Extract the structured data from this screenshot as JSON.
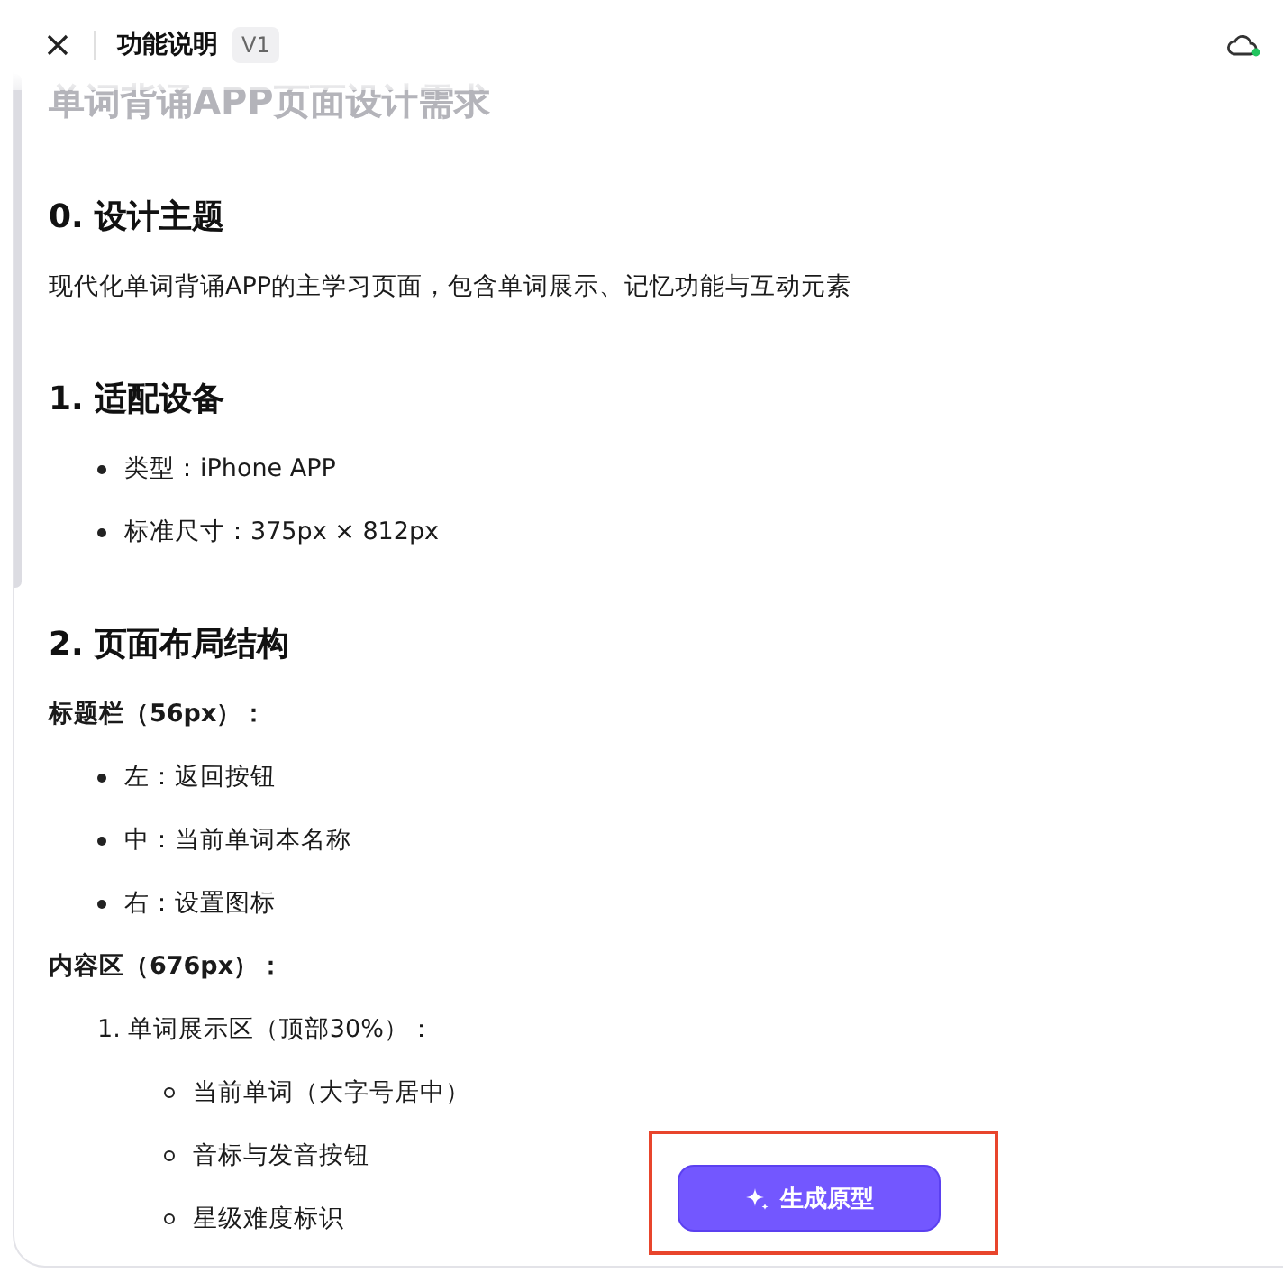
{
  "header": {
    "title": "功能说明",
    "version": "V1",
    "synced": true
  },
  "document": {
    "title": "单词背诵APP页面设计需求",
    "sections": [
      {
        "heading": "0. 设计主题",
        "blocks": [
          {
            "kind": "paragraph",
            "text": "现代化单词背诵APP的主学习页面，包含单词展示、记忆功能与互动元素"
          }
        ]
      },
      {
        "heading": "1. 适配设备",
        "blocks": [
          {
            "kind": "bullets",
            "items": [
              "类型：iPhone APP",
              "标准尺寸：375px × 812px"
            ]
          }
        ]
      },
      {
        "heading": "2. 页面布局结构",
        "blocks": [
          {
            "kind": "label",
            "text": "标题栏（56px）："
          },
          {
            "kind": "bullets",
            "items": [
              "左：返回按钮",
              "中：当前单词本名称",
              "右：设置图标"
            ]
          },
          {
            "kind": "label",
            "text": "内容区（676px）："
          },
          {
            "kind": "numbered",
            "items": [
              {
                "number": "1.",
                "text": "单词展示区（顶部30%）：",
                "children": [
                  "当前单词（大字号居中）",
                  "音标与发音按钮",
                  "星级难度标识"
                ]
              }
            ]
          }
        ]
      }
    ]
  },
  "action_button": {
    "label": "生成原型",
    "highlighted": true
  }
}
